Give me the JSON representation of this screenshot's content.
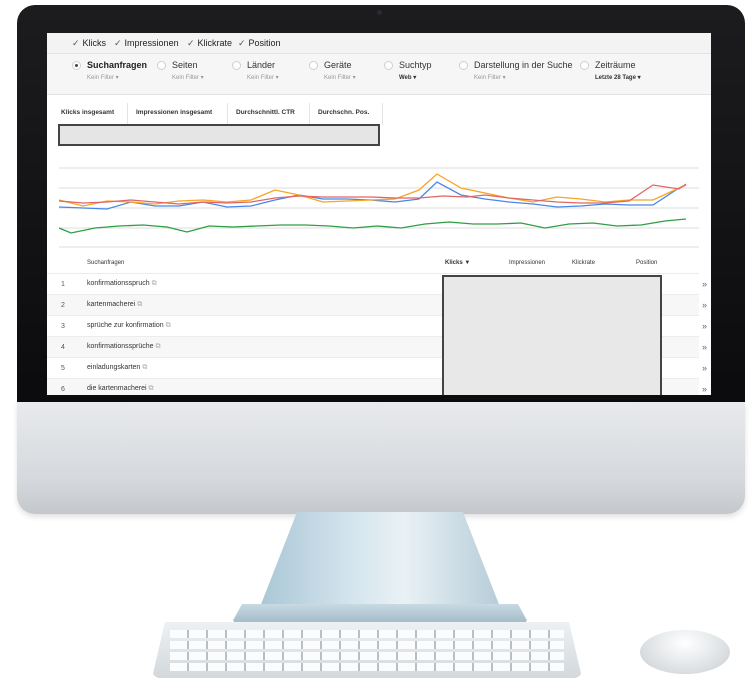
{
  "metrics": [
    {
      "label": "Klicks"
    },
    {
      "label": "Impressionen"
    },
    {
      "label": "Klickrate"
    },
    {
      "label": "Position"
    }
  ],
  "check_glyph": "✓",
  "dimensions": [
    {
      "label": "Suchanfragen",
      "sub": "Kein Filter ▾",
      "selected": true
    },
    {
      "label": "Seiten",
      "sub": "Kein Filter ▾"
    },
    {
      "label": "Länder",
      "sub": "Kein Filter ▾"
    },
    {
      "label": "Geräte",
      "sub": "Kein Filter ▾"
    },
    {
      "label": "Suchtyp",
      "sub": "Web ▾"
    },
    {
      "label": "Darstellung in der Suche",
      "sub": "Kein Filter ▾"
    },
    {
      "label": "Zeiträume",
      "sub": "Letzte 28 Tage ▾"
    }
  ],
  "summary": {
    "headers": [
      "Klicks insgesamt",
      "Impressionen insgesamt",
      "Durchschnittl. CTR",
      "Durchschn. Pos."
    ]
  },
  "colors": {
    "clicks": "#4a86e8",
    "impressions": "#e06666",
    "ctr": "#f6a524",
    "position": "#2f9e44"
  },
  "table": {
    "headers": {
      "query": "Suchanfragen",
      "clicks": "Klicks ▼",
      "impressions": "Impressionen",
      "ctr": "Klickrate",
      "position": "Position"
    },
    "more_glyph": "»",
    "rows": [
      {
        "num": "1",
        "query": "konfirmationsspruch"
      },
      {
        "num": "2",
        "query": "kartenmacherei"
      },
      {
        "num": "3",
        "query": "sprüche zur konfirmation"
      },
      {
        "num": "4",
        "query": "konfirmationssprüche"
      },
      {
        "num": "5",
        "query": "einladungskarten"
      },
      {
        "num": "6",
        "query": "die kartenmacherei"
      }
    ]
  }
}
